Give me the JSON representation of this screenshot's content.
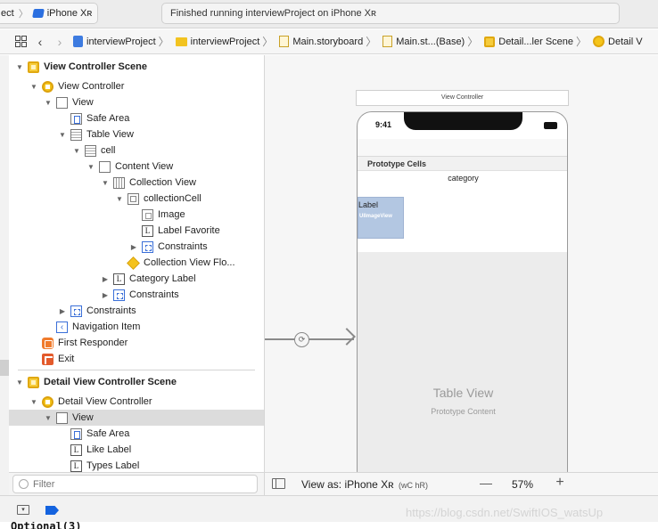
{
  "toolbar": {
    "scheme_left": "ect",
    "scheme_device": "iPhone Xʀ",
    "activity": "Finished running interviewProject on iPhone Xʀ"
  },
  "jumpbar": {
    "crumbs": [
      "interviewProject",
      "interviewProject",
      "Main.storyboard",
      "Main.st...(Base)",
      "Detail...ler Scene",
      "Detail V"
    ]
  },
  "outline": {
    "rows": [
      "View Controller Scene",
      "View Controller",
      "View",
      "Safe Area",
      "Table View",
      "cell",
      "Content View",
      "Collection View",
      "collectionCell",
      "Image",
      "Label Favorite",
      "Constraints",
      "Collection View Flo...",
      "Category Label",
      "Constraints",
      "Constraints",
      "Navigation Item",
      "First Responder",
      "Exit",
      "Detail View Controller Scene",
      "Detail View Controller",
      "View",
      "Safe Area",
      "Like Label",
      "Types Label"
    ],
    "filter_placeholder": "Filter"
  },
  "canvas": {
    "vc_title": "View Controller",
    "time": "9:41",
    "prototype_cells": "Prototype Cells",
    "category": "category",
    "cell_label": "Label",
    "cell_image": "UIImageView",
    "table_view": "Table View",
    "prototype_content": "Prototype Content"
  },
  "canvas_bar": {
    "view_as": "View as: iPhone Xʀ",
    "view_as_suffix": "(wC hR)",
    "zoom": "57%"
  },
  "debug": {
    "watermark": "https://blog.csdn.net/SwiftIOS_watsUp",
    "console": "Optional(3)"
  }
}
